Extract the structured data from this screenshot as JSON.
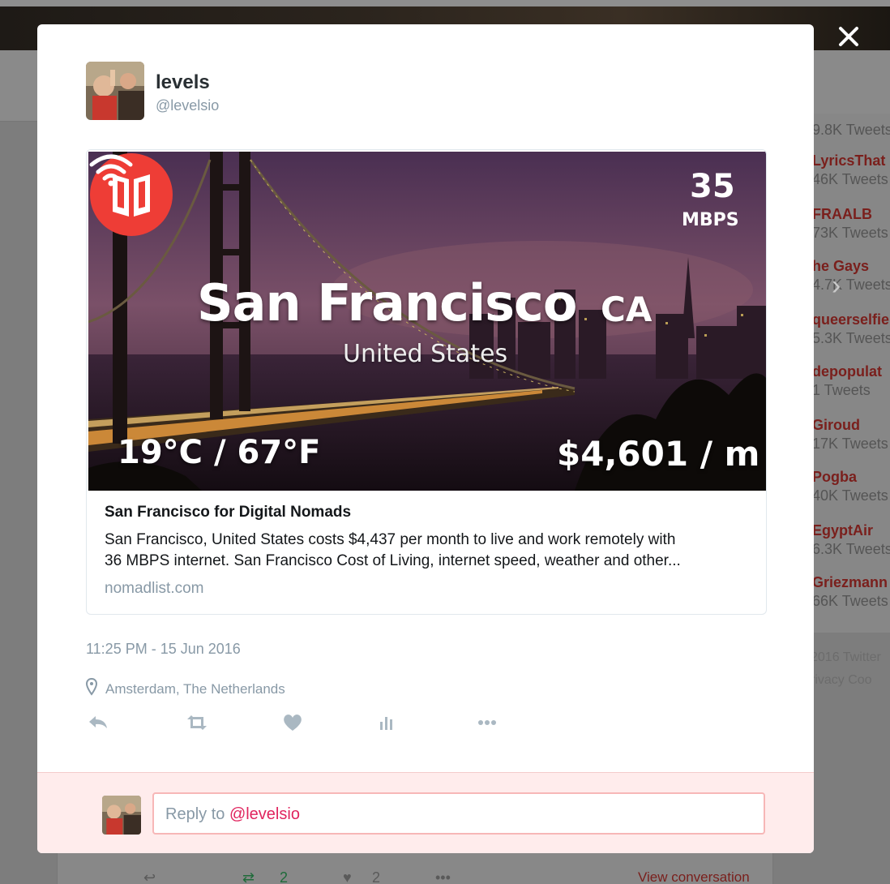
{
  "background": {
    "trends": [
      {
        "name": "",
        "count": "9.8K Tweets"
      },
      {
        "name": "LyricsThat",
        "count": "46K Tweets"
      },
      {
        "name": "FRAALB",
        "count": "73K Tweets"
      },
      {
        "name": "he Gays",
        "count": "4.7K Tweets"
      },
      {
        "name": "queerselfie",
        "count": "5.3K Tweets"
      },
      {
        "name": "depopulat",
        "count": "1 Tweets"
      },
      {
        "name": "Giroud",
        "count": "17K Tweets"
      },
      {
        "name": "Pogba",
        "count": "40K Tweets"
      },
      {
        "name": "EgyptAir",
        "count": "6.3K Tweets"
      },
      {
        "name": "Griezmann",
        "count": "66K Tweets"
      }
    ],
    "footer": [
      "2016 Twitter",
      "rivacy   Coo"
    ],
    "bottom_counts": {
      "retweets": "2",
      "likes": "2"
    },
    "view_conversation": "View conversation"
  },
  "tweet": {
    "author": {
      "name": "levels",
      "handle": "@levelsio"
    },
    "card": {
      "image": {
        "city": "San Francisco",
        "state": "CA",
        "country": "United States",
        "speed_value": "35",
        "speed_unit": "MBPS",
        "temperature": "19°C /  67°F",
        "cost": "$4,601 / m"
      },
      "title": "San Francisco for Digital Nomads",
      "description_line1": "San Francisco, United States costs $4,437 per month to live and work remotely with",
      "description_line2": "36 MBPS internet. San Francisco Cost of Living, internet speed, weather and other...",
      "domain": "nomadlist.com"
    },
    "timestamp": "11:25 PM - 15 Jun 2016",
    "location": "Amsterdam, The Netherlands",
    "actions": [
      "reply-icon",
      "retweet-icon",
      "like-icon",
      "analytics-icon",
      "more-icon"
    ]
  },
  "reply": {
    "prefix": "Reply to ",
    "mention": "@levelsio"
  },
  "colors": {
    "accent": "#e0245e",
    "muted": "#8899a6",
    "text": "#14171a",
    "logo": "#ee3d36"
  }
}
